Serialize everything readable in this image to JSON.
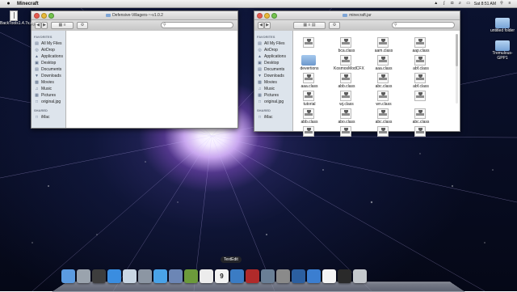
{
  "menubar": {
    "app_name": "Minecraft",
    "clock": "Sat 8:51 AM",
    "icons": [
      "apple-icon",
      "notification-icon",
      "bluetooth-icon",
      "wifi-icon",
      "volume-icon",
      "battery-icon",
      "spotlight-icon",
      "list-icon"
    ]
  },
  "window_left": {
    "title": "Defensive-Villagers-~-v1.0.2",
    "search_placeholder": "",
    "sidebar": {
      "favorites_heading": "FAVORITES",
      "items": [
        {
          "label": "All My Files",
          "icon": "all-files-icon"
        },
        {
          "label": "AirDrop",
          "icon": "airdrop-icon"
        },
        {
          "label": "Applications",
          "icon": "applications-icon"
        },
        {
          "label": "Desktop",
          "icon": "desktop-icon"
        },
        {
          "label": "Documents",
          "icon": "documents-icon"
        },
        {
          "label": "Downloads",
          "icon": "downloads-icon"
        },
        {
          "label": "Movies",
          "icon": "movies-icon"
        },
        {
          "label": "Music",
          "icon": "music-icon"
        },
        {
          "label": "Pictures",
          "icon": "pictures-icon"
        },
        {
          "label": "original.jpg",
          "icon": "image-file-icon"
        }
      ],
      "shared_heading": "SHARED",
      "shared_items": [
        {
          "label": "iMac",
          "icon": "imac-icon"
        }
      ]
    }
  },
  "window_right": {
    "title": "minecraft.jar",
    "sidebar": {
      "favorites_heading": "FAVORITES",
      "items": [
        {
          "label": "All My Files",
          "icon": "all-files-icon"
        },
        {
          "label": "AirDrop",
          "icon": "airdrop-icon"
        },
        {
          "label": "Applications",
          "icon": "applications-icon"
        },
        {
          "label": "Desktop",
          "icon": "desktop-icon"
        },
        {
          "label": "Documents",
          "icon": "documents-icon"
        },
        {
          "label": "Downloads",
          "icon": "downloads-icon"
        },
        {
          "label": "Movies",
          "icon": "movies-icon"
        },
        {
          "label": "Music",
          "icon": "music-icon"
        },
        {
          "label": "Pictures",
          "icon": "pictures-icon"
        },
        {
          "label": "original.jpg",
          "icon": "image-file-icon"
        }
      ],
      "shared_heading": "SHARED",
      "shared_items": [
        {
          "label": "iMac",
          "icon": "imac-icon"
        }
      ]
    },
    "files": [
      {
        "name": "",
        "kind": "doc"
      },
      {
        "name": "bca.class",
        "kind": "doc"
      },
      {
        "name": "aam.class",
        "kind": "doc"
      },
      {
        "name": "aap.class",
        "kind": "doc"
      },
      {
        "name": "devertions",
        "kind": "folder"
      },
      {
        "name": "KosmosModCFX",
        "kind": "doc"
      },
      {
        "name": "aaa.class",
        "kind": "doc"
      },
      {
        "name": "abf.class",
        "kind": "doc"
      },
      {
        "name": "aaa.class",
        "kind": "doc"
      },
      {
        "name": "abb.class",
        "kind": "doc"
      },
      {
        "name": "abc.class",
        "kind": "doc"
      },
      {
        "name": "abf.class",
        "kind": "doc"
      },
      {
        "name": "tutorial",
        "kind": "doc"
      },
      {
        "name": "wj.class",
        "kind": "doc"
      },
      {
        "name": "wn.class",
        "kind": "doc"
      },
      {
        "name": "",
        "kind": "doc"
      },
      {
        "name": "abb.class",
        "kind": "doc"
      },
      {
        "name": "abo.class",
        "kind": "doc"
      },
      {
        "name": "abc.class",
        "kind": "doc"
      },
      {
        "name": "abc.class",
        "kind": "doc"
      },
      {
        "name": "",
        "kind": "doc"
      },
      {
        "name": "",
        "kind": "doc"
      },
      {
        "name": "",
        "kind": "doc"
      },
      {
        "name": "",
        "kind": "doc"
      }
    ]
  },
  "desktop_icons": [
    {
      "label": "BackTools1.4.7v.zip",
      "kind": "zip"
    },
    {
      "label": "untitled folder",
      "kind": "folder"
    },
    {
      "label": "Tremulous-GPP1",
      "kind": "folder"
    }
  ],
  "dock": {
    "tooltip": "TextEdit",
    "calendar_day": "9",
    "items": [
      {
        "name": "finder-icon",
        "color": "#5b9be0"
      },
      {
        "name": "launchpad-icon",
        "color": "#9aa3ad"
      },
      {
        "name": "dashboard-icon",
        "color": "#3d3d3d"
      },
      {
        "name": "app-store-icon",
        "color": "#3a8de0"
      },
      {
        "name": "preview-icon",
        "color": "#c9d6e3"
      },
      {
        "name": "disk-utility-icon",
        "color": "#8c96a3"
      },
      {
        "name": "safari-icon",
        "color": "#4aa3e8"
      },
      {
        "name": "mail-icon",
        "color": "#6c86b5"
      },
      {
        "name": "minecraft-icon",
        "color": "#6c9a3b"
      },
      {
        "name": "textedit-icon",
        "color": "#ececec"
      },
      {
        "name": "calendar-icon",
        "color": "#f2f2f2"
      },
      {
        "name": "itunes-icon",
        "color": "#3b7cc4"
      },
      {
        "name": "photo-booth-icon",
        "color": "#b02a2a"
      },
      {
        "name": "iphoto-icon",
        "color": "#6a7f96"
      },
      {
        "name": "system-preferences-icon",
        "color": "#8a8a8a"
      },
      {
        "name": "screen-sharing-icon",
        "color": "#2b5fa0"
      },
      {
        "name": "network-icon",
        "color": "#3b7ed0"
      },
      {
        "name": "document-icon",
        "color": "#f4f4f4"
      },
      {
        "name": "terminal-icon",
        "color": "#2a2a2a"
      },
      {
        "name": "trash-icon",
        "color": "#c4c8cc"
      }
    ]
  }
}
